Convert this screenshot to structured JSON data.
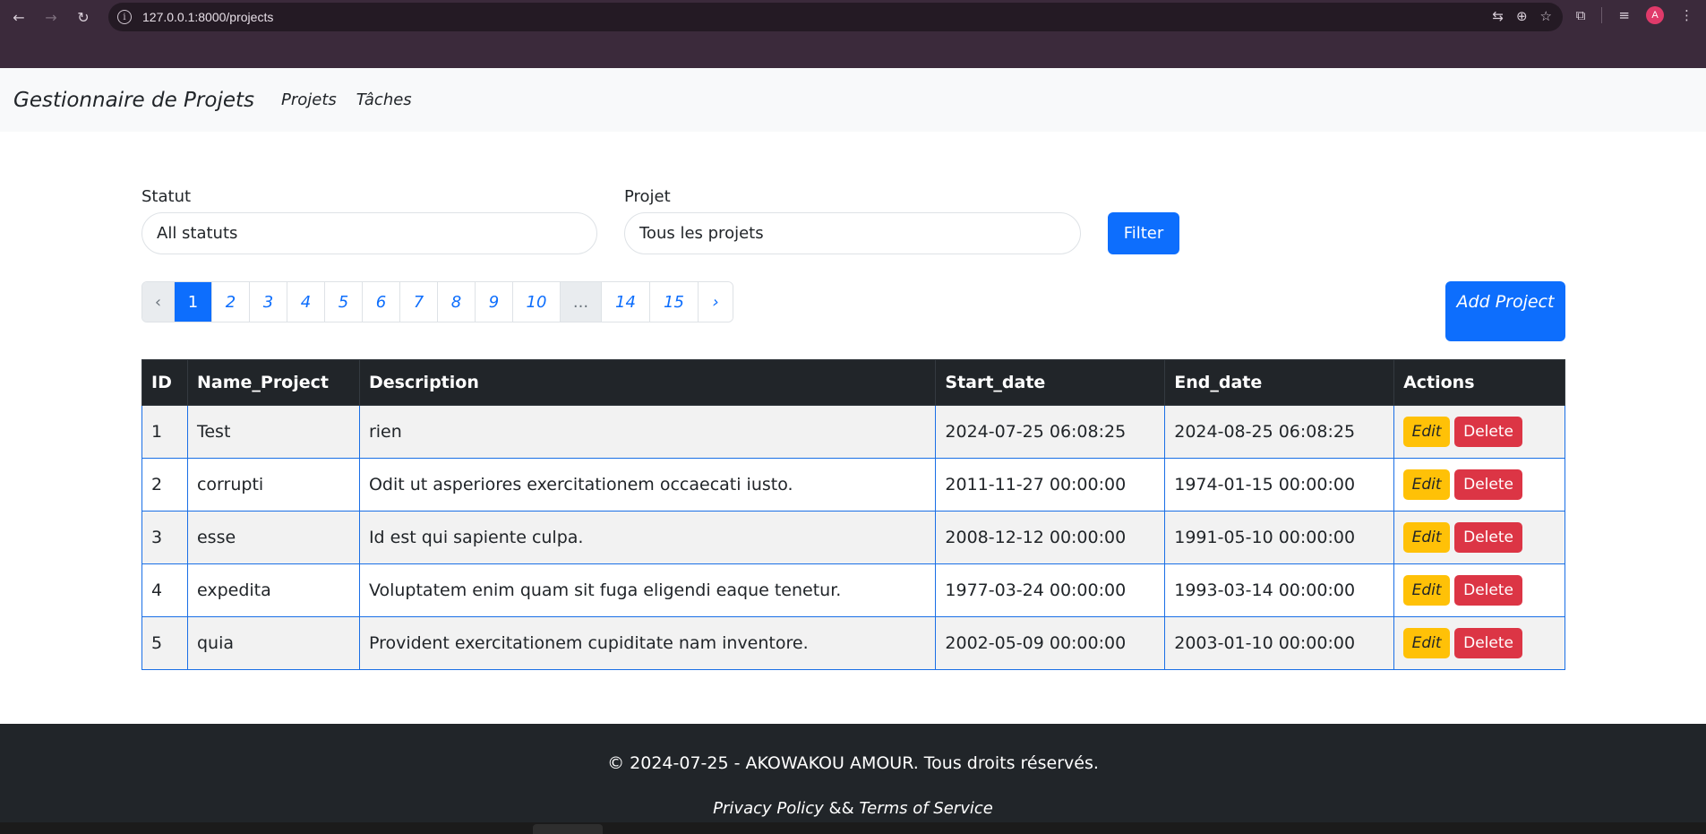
{
  "browser": {
    "url": "127.0.0.1:8000/projects",
    "profile_initial": "A"
  },
  "navbar": {
    "brand": "Gestionnaire de Projets",
    "links": [
      "Projets",
      "Tâches"
    ]
  },
  "filters": {
    "status_label": "Statut",
    "status_value": "All statuts",
    "project_label": "Projet",
    "project_value": "Tous les projets",
    "filter_button": "Filter"
  },
  "pagination": {
    "prev": "‹",
    "next": "›",
    "pages": [
      "1",
      "2",
      "3",
      "4",
      "5",
      "6",
      "7",
      "8",
      "9",
      "10",
      "...",
      "14",
      "15"
    ],
    "active": "1"
  },
  "add_project_button": "Add Project",
  "table": {
    "columns": [
      "ID",
      "Name_Project",
      "Description",
      "Start_date",
      "End_date",
      "Actions"
    ],
    "rows": [
      {
        "id": "1",
        "name": "Test",
        "description": "rien",
        "start": "2024-07-25 06:08:25",
        "end": "2024-08-25 06:08:25"
      },
      {
        "id": "2",
        "name": "corrupti",
        "description": "Odit ut asperiores exercitationem occaecati iusto.",
        "start": "2011-11-27 00:00:00",
        "end": "1974-01-15 00:00:00"
      },
      {
        "id": "3",
        "name": "esse",
        "description": "Id est qui sapiente culpa.",
        "start": "2008-12-12 00:00:00",
        "end": "1991-05-10 00:00:00"
      },
      {
        "id": "4",
        "name": "expedita",
        "description": "Voluptatem enim quam sit fuga eligendi eaque tenetur.",
        "start": "1977-03-24 00:00:00",
        "end": "1993-03-14 00:00:00"
      },
      {
        "id": "5",
        "name": "quia",
        "description": "Provident exercitationem cupiditate nam inventore.",
        "start": "2002-05-09 00:00:00",
        "end": "2003-01-10 00:00:00"
      }
    ],
    "edit_label": "Edit",
    "delete_label": "Delete"
  },
  "footer": {
    "copyright": "© 2024-07-25 - AKOWAKOU AMOUR. Tous droits réservés.",
    "privacy": "Privacy Policy",
    "separator": "&&",
    "terms": "Terms of Service"
  },
  "colors": {
    "primary": "#0d6efd",
    "warning": "#ffc107",
    "danger": "#dc3545",
    "dark": "#212529"
  }
}
